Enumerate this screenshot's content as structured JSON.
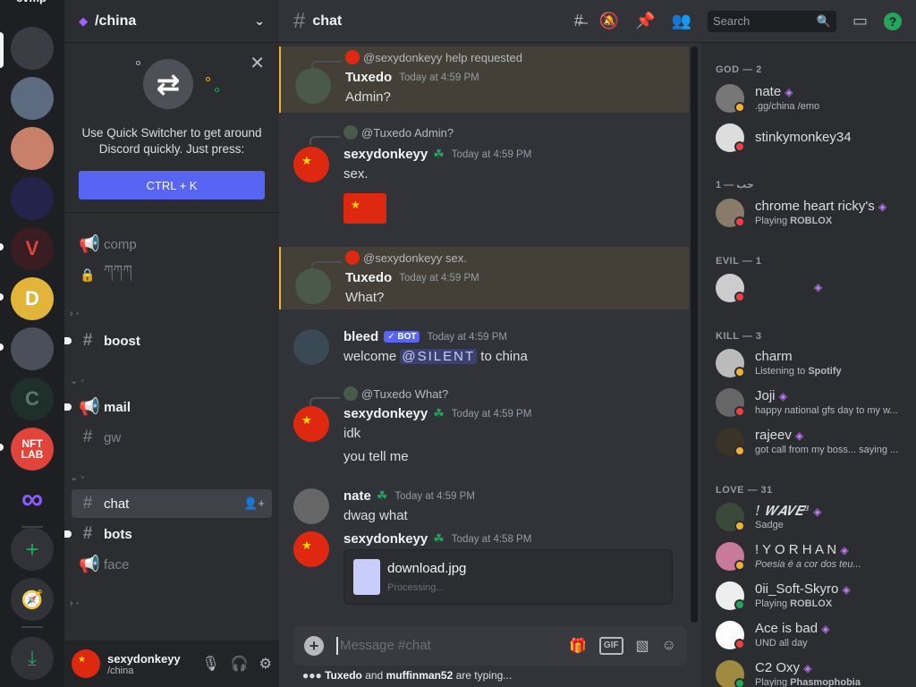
{
  "rail": {
    "title": "cvmp",
    "servers": [
      {
        "name": "server-1",
        "color": "#3a3d44",
        "label": ""
      },
      {
        "name": "server-2",
        "color": "#5c6b80",
        "label": ""
      },
      {
        "name": "server-3",
        "color": "#c9806a",
        "label": ""
      },
      {
        "name": "server-4",
        "color": "#24244a",
        "label": ""
      },
      {
        "name": "server-5",
        "color": "#3a1d22",
        "label": "V"
      },
      {
        "name": "server-6",
        "color": "#e2b53a",
        "label": "D"
      },
      {
        "name": "server-7",
        "color": "#4a4f5a",
        "label": ""
      },
      {
        "name": "server-8",
        "color": "#1f2f2a",
        "label": "C"
      },
      {
        "name": "server-9",
        "color": "#e0443a",
        "label": "NFT LAB"
      },
      {
        "name": "server-10",
        "color": "#1e1f22",
        "label": "∞"
      }
    ]
  },
  "sidebar": {
    "server_name": "/china",
    "quick_switcher": {
      "text_line1": "Use Quick Switcher to get around",
      "text_line2": "Discord quickly. Just press:",
      "shortcut": "CTRL + K"
    },
    "channels": [
      {
        "label": "comp",
        "symbol": "📢",
        "state": "muted"
      },
      {
        "label": "ཀཀཀ",
        "symbol": "🔒",
        "state": "muted"
      },
      {
        "label": "boost",
        "symbol": "#",
        "state": "unread"
      },
      {
        "label": "mail",
        "symbol": "📢",
        "state": "unread"
      },
      {
        "label": "gw",
        "symbol": "#",
        "state": "muted"
      },
      {
        "label": "chat",
        "symbol": "#",
        "state": "active"
      },
      {
        "label": "bots",
        "symbol": "#",
        "state": "unread"
      },
      {
        "label": "face",
        "symbol": "📢",
        "state": "muted"
      }
    ],
    "user": {
      "name": "sexydonkeyy",
      "status": "/china"
    }
  },
  "header": {
    "channel": "chat",
    "search_placeholder": "Search"
  },
  "messages": [
    {
      "reply_to": "@sexydonkeyy help requested",
      "author": "Tuxedo",
      "time": "Today at 4:59 PM",
      "text": "Admin?",
      "highlight": true
    },
    {
      "reply_to": "@Tuxedo Admin?",
      "author": "sexydonkeyy",
      "time": "Today at 4:59 PM",
      "text": "sex.",
      "highlight": false
    },
    {
      "reply_to": "@sexydonkeyy sex.",
      "author": "Tuxedo",
      "time": "Today at 4:59 PM",
      "text": "What?",
      "highlight": true
    },
    {
      "author": "bleed",
      "bot_tag": "✓ BOT",
      "time": "Today at 4:59 PM",
      "text_pre": "welcome ",
      "mention": "@SILENT",
      "text_post": " to china"
    },
    {
      "reply_to": "@Tuxedo What?",
      "author": "sexydonkeyy",
      "time": "Today at 4:59 PM",
      "text": "idk",
      "text2": "you tell me"
    },
    {
      "author": "nate",
      "time": "Today at 4:59 PM",
      "text": "dwag what"
    },
    {
      "author": "sexydonkeyy",
      "time": "Today at 4:58 PM",
      "attachment": "download.jpg",
      "attachment_status": "Processing..."
    }
  ],
  "composer": {
    "placeholder": "Message #chat",
    "gif": "GIF"
  },
  "typing": {
    "user1": "Tuxedo",
    "and": " and ",
    "user2": "muffinman52",
    "suffix": " are typing..."
  },
  "members": {
    "groups": [
      {
        "title": "GOD — 2"
      },
      {
        "title": "حب — 1"
      },
      {
        "title": "EVIL — 1"
      },
      {
        "title": "KILL — 3"
      },
      {
        "title": "LOVE — 31"
      }
    ],
    "list": [
      {
        "name": "nate",
        "sub": ".gg/china /emo",
        "status": "#f0b232",
        "avatar": "#777"
      },
      {
        "name": "stinkymonkey34",
        "sub": "",
        "status": "#f23f43",
        "avatar": "#ddd"
      },
      {
        "name": "chrome heart ricky's",
        "sub_pre": "Playing ",
        "sub_b": "ROBLOX",
        "status": "#f23f43",
        "avatar": "#8a7a6a"
      },
      {
        "name": "",
        "sub": "",
        "status": "#f23f43",
        "avatar": "#ccc"
      },
      {
        "name": "charm",
        "sub_pre": "Listening to ",
        "sub_b": "Spotify",
        "status": "#f0b232",
        "avatar": "#bbb"
      },
      {
        "name": "Joji",
        "sub": "happy national gfs day to my w...",
        "status": "#f23f43",
        "avatar": "#666"
      },
      {
        "name": "rajeev",
        "sub": "got call from my boss... saying ...",
        "status": "#f0b232",
        "avatar": "#3a3428"
      },
      {
        "name": "! 𝑾𝑨𝑽𝑬⁸",
        "sub": "Sadge",
        "status": "#f0b232",
        "avatar": "#3a4a3a"
      },
      {
        "name": "! Y O R H A N",
        "sub": "Poesia é a cor dos teu...",
        "status": "#f0b232",
        "avatar": "#c87a9a"
      },
      {
        "name": "0ii_Soft-Skyro",
        "sub_pre": "Playing ",
        "sub_b": "ROBLOX",
        "status": "#23a55a",
        "avatar": "#eee"
      },
      {
        "name": "Ace is bad",
        "sub": "UND all day",
        "status": "#f23f43",
        "avatar": "#fff"
      },
      {
        "name": "C2 Oxy",
        "sub_pre": "Playing ",
        "sub_b": "Phasmophobia",
        "status": "#23a55a",
        "avatar": "#a08a40"
      }
    ]
  }
}
